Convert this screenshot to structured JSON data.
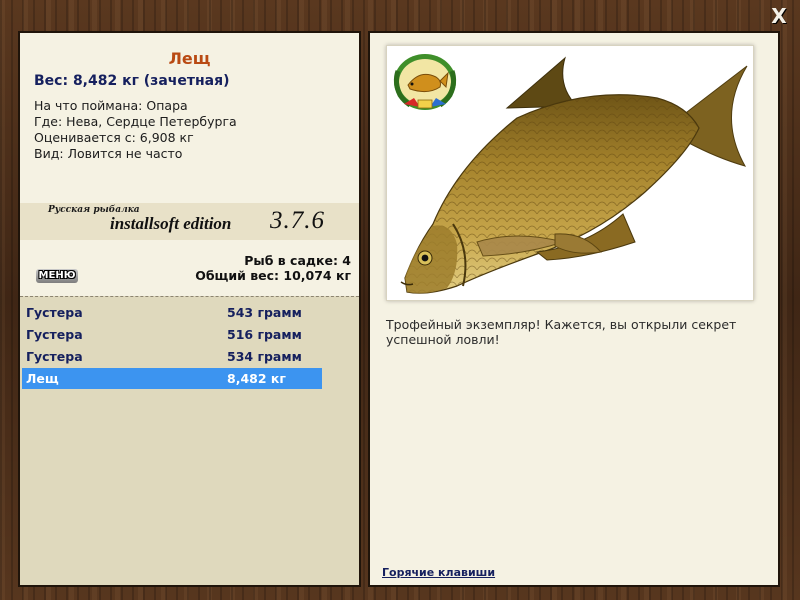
{
  "window": {
    "close_label": "X"
  },
  "fish": {
    "name": "Лещ",
    "weight_line": "Вес: 8,482 кг (зачетная)",
    "info": [
      {
        "label": "На что поймана:",
        "value": "Опара"
      },
      {
        "label": "Где:",
        "value": "Нева, Сердце Петербурга"
      },
      {
        "label": "Оценивается с:",
        "value": "6,908 кг"
      },
      {
        "label": "Вид:",
        "value": "Ловится не часто"
      }
    ]
  },
  "banner": {
    "small": "Русская рыбалка",
    "main": "installsoft edition",
    "version": "3.7.6"
  },
  "menu_label": "МЕНЮ",
  "cage": {
    "count_line": "Рыб в садке: 4",
    "total_line": "Общий вес: 10,074 кг"
  },
  "catches": [
    {
      "name": "Густера",
      "weight": "543 грамм",
      "selected": false
    },
    {
      "name": "Густера",
      "weight": "516 грамм",
      "selected": false
    },
    {
      "name": "Густера",
      "weight": "534 грамм",
      "selected": false
    },
    {
      "name": "Лещ",
      "weight": "8,482 кг",
      "selected": true
    }
  ],
  "trophy_text": "Трофейный экземпляр! Кажется, вы открыли секрет успешной ловли!",
  "hotkeys_label": "Горячие клавиши",
  "icons": {
    "close": "close-icon",
    "trophy": "trophy-medal-icon",
    "fish": "bream-fish-image"
  },
  "colors": {
    "title": "#b94a13",
    "weight": "#15205e",
    "selected_row": "#3c94f0",
    "panel": "#f5f2e3",
    "list_bg": "#dfd9bd"
  }
}
